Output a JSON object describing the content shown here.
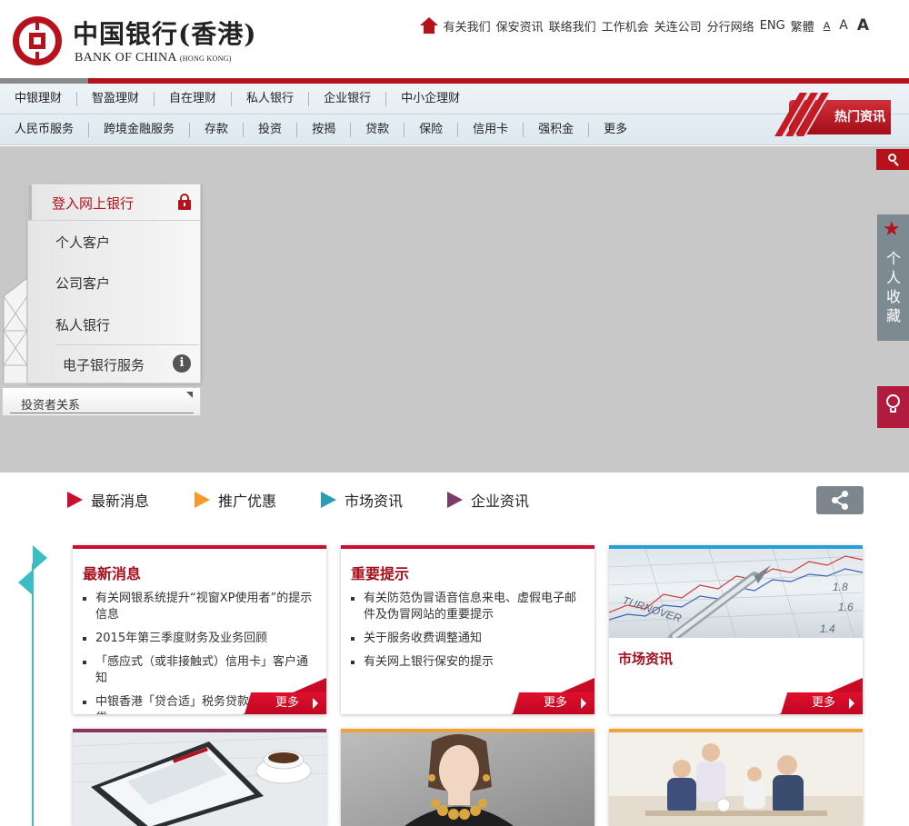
{
  "header": {
    "logo_cn": "中国银行(香港)",
    "logo_en": "BANK OF CHINA",
    "logo_en_small": "(HONG KONG)",
    "top_links": [
      "有关我们",
      "保安资讯",
      "联络我们",
      "工作机会",
      "关连公司",
      "分行网络",
      "ENG",
      "繁體"
    ],
    "font_sizes": [
      "A",
      "A",
      "A"
    ]
  },
  "nav": {
    "row1": [
      "中银理财",
      "智盈理财",
      "自在理财",
      "私人银行",
      "企业银行",
      "中小企理财"
    ],
    "row2": [
      "人民币服务",
      "跨境金融服务",
      "存款",
      "投资",
      "按揭",
      "贷款",
      "保险",
      "信用卡",
      "强积金",
      "更多"
    ],
    "hot_news": "热门资讯"
  },
  "login": {
    "title": "登入网上银行",
    "items": [
      "个人客户",
      "公司客户",
      "私人银行"
    ],
    "ebank": "电子银行服务"
  },
  "investor": {
    "label": "投资者关系"
  },
  "favorites": {
    "label": [
      "个",
      "人",
      "收",
      "藏"
    ]
  },
  "tabs": [
    {
      "label": "最新消息",
      "color": "#c80f2e"
    },
    {
      "label": "推广优惠",
      "color": "#f39a2e"
    },
    {
      "label": "市场资讯",
      "color": "#2a9fb3"
    },
    {
      "label": "企业资讯",
      "color": "#7a3b66"
    }
  ],
  "cards": {
    "news": {
      "title": "最新消息",
      "items": [
        "有关网银系统提升“视窗XP使用者”的提示信息",
        "2015年第三季度财务及业务回顾",
        "「感应式（或非接触式）信用卡」客户通知",
        "中银香港「贷合适」税务贷款特惠高额贷..."
      ],
      "more": "更多"
    },
    "alerts": {
      "title": "重要提示",
      "items": [
        "有关防范伪冒语音信息来电、虚假电子邮件及伪冒网站的重要提示",
        "关于服务收费调整通知",
        "有关网上银行保安的提示"
      ],
      "more": "更多"
    },
    "market": {
      "title": "市场资讯",
      "more": "更多",
      "chart_words": [
        "TURNOVER",
        "1.8",
        "1.6",
        "1.4"
      ]
    }
  },
  "colors": {
    "brand_red": "#b5121b",
    "teal": "#3cbcc3",
    "banner_grey": "#c8c8c8"
  }
}
